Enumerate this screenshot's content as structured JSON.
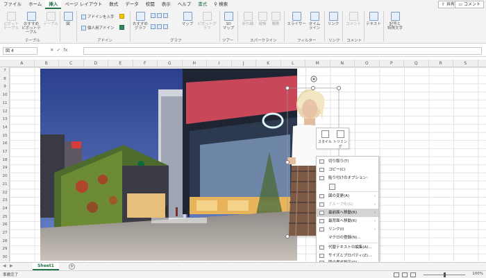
{
  "menu": {
    "tabs": [
      "ファイル",
      "ホーム",
      "挿入",
      "ページ レイアウト",
      "数式",
      "データ",
      "校閲",
      "表示",
      "ヘルプ",
      "書式"
    ],
    "active_index": 2,
    "search_label": "検索",
    "share_label": "共有",
    "comment_label": "コメント"
  },
  "ribbon": {
    "pivot": "ピボット\nテーブル",
    "recommended_pivot": "おすすめ\nピボットテーブル",
    "table": "テーブル",
    "group_table": "テーブル",
    "illustrations": "図",
    "get_addins": "アドインを入手",
    "my_addins": "個人用アドイン",
    "group_addins": "アドイン",
    "recommended_charts": "おすすめ\nグラフ",
    "maps": "マップ",
    "pivot_chart": "ピボットグラフ",
    "group_charts": "グラフ",
    "map3d": "3D\nマップ",
    "group_tour": "ツアー",
    "sparkline_line": "折れ線",
    "sparkline_column": "縦棒",
    "sparkline_winloss": "勝敗",
    "group_sparklines": "スパークライン",
    "slicer": "スライサー",
    "timeline": "タイム\nライン",
    "group_filters": "フィルター",
    "link": "リンク",
    "group_links": "リンク",
    "comment": "コメント",
    "group_comments": "コメント",
    "text": "テキスト",
    "symbols": "記号と\n特殊文字"
  },
  "formula": {
    "namebox": "図 4",
    "fx": "fx"
  },
  "columns": [
    "A",
    "B",
    "C",
    "D",
    "E",
    "F",
    "G",
    "H",
    "I",
    "J",
    "K",
    "L",
    "M",
    "N",
    "O",
    "P",
    "Q",
    "R",
    "S"
  ],
  "rows": [
    "7",
    "8",
    "9",
    "10",
    "11",
    "12",
    "13",
    "14",
    "15",
    "16",
    "17",
    "18",
    "19",
    "20",
    "21",
    "22",
    "23",
    "24",
    "25",
    "26",
    "27",
    "28",
    "29",
    "30"
  ],
  "minitoolbar": {
    "style": "スタイル",
    "crop": "トリミング"
  },
  "context_menu": [
    {
      "label": "切り取り(T)",
      "disabled": false,
      "arrow": false
    },
    {
      "label": "コピー(C)",
      "disabled": false,
      "arrow": false
    },
    {
      "label": "貼り付けのオプション:",
      "disabled": false,
      "arrow": false
    },
    {
      "label": "",
      "disabled": false,
      "arrow": false
    },
    {
      "label": "図の変更(A)",
      "disabled": false,
      "arrow": true
    },
    {
      "label": "グループ化(G)",
      "disabled": true,
      "arrow": true
    },
    {
      "label": "最前面へ移動(R)",
      "disabled": false,
      "arrow": true,
      "highlight": true
    },
    {
      "label": "最背面へ移動(K)",
      "disabled": false,
      "arrow": true
    },
    {
      "label": "リンク(I)",
      "disabled": false,
      "arrow": true
    },
    {
      "label": "マクロの登録(N)...",
      "disabled": false,
      "arrow": false
    },
    {
      "label": "代替テキストの編集(A)...",
      "disabled": false,
      "arrow": false
    },
    {
      "label": "サイズとプロパティ(Z)...",
      "disabled": false,
      "arrow": false
    },
    {
      "label": "図の書式設定(O)...",
      "disabled": false,
      "arrow": false
    }
  ],
  "sheet": {
    "tab": "Sheet1"
  },
  "status": {
    "ready": "準備完了",
    "zoom": "100%"
  }
}
